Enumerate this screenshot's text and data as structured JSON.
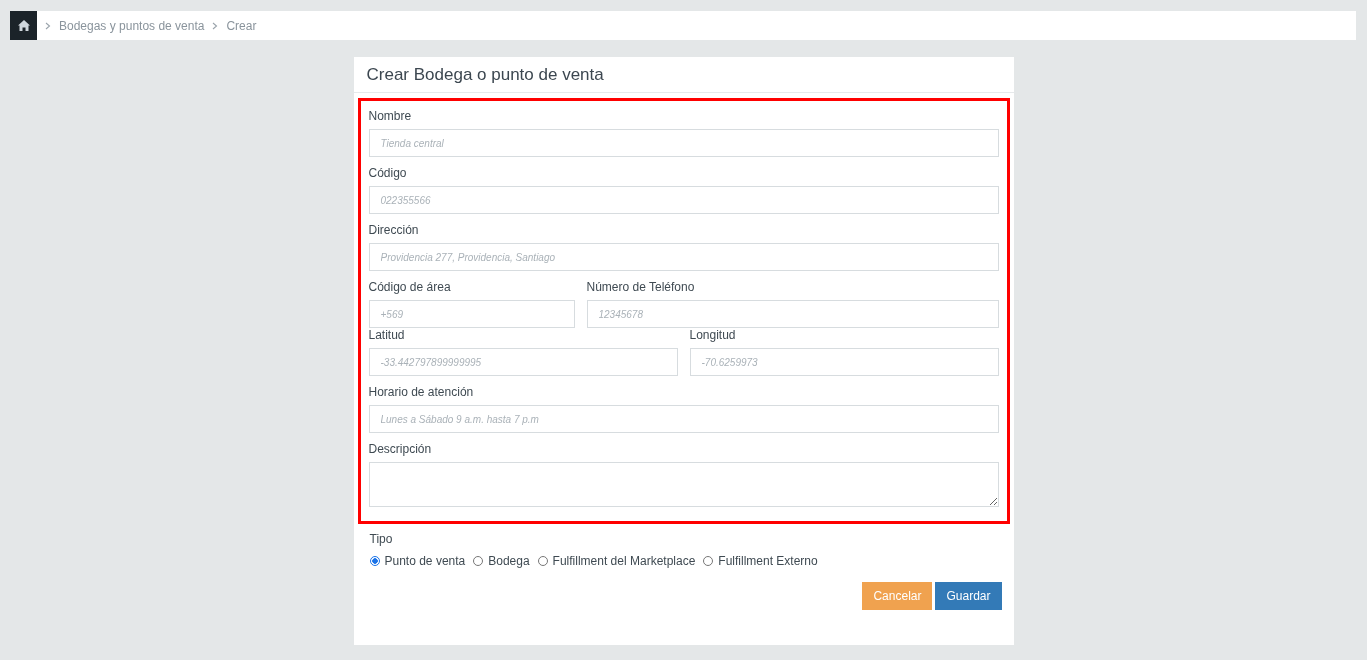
{
  "breadcrumb": {
    "items": [
      "Bodegas y puntos de venta",
      "Crear"
    ]
  },
  "card": {
    "title": "Crear Bodega o punto de venta"
  },
  "form": {
    "highlighted": true,
    "rows": [
      {
        "fields": [
          {
            "kind": "input",
            "label": "Nombre",
            "placeholder": "Tienda central"
          }
        ]
      },
      {
        "fields": [
          {
            "kind": "input",
            "label": "Código",
            "placeholder": "022355566"
          }
        ]
      },
      {
        "fields": [
          {
            "kind": "input",
            "label": "Dirección",
            "placeholder": "Providencia 277, Providencia, Santiago"
          }
        ]
      },
      {
        "fields": [
          {
            "kind": "input",
            "label": "Código de área",
            "placeholder": "+569"
          },
          {
            "kind": "input",
            "label": "Número de Teléfono",
            "placeholder": "12345678"
          }
        ]
      },
      {
        "fields": [
          {
            "kind": "input",
            "label": "Latitud",
            "placeholder": "-33.442797899999995"
          },
          {
            "kind": "input",
            "label": "Longitud",
            "placeholder": "-70.6259973"
          }
        ]
      },
      {
        "fields": [
          {
            "kind": "input",
            "label": "Horario de atención",
            "placeholder": "Lunes a Sábado 9 a.m. hasta 7 p.m"
          }
        ]
      },
      {
        "fields": [
          {
            "kind": "textarea",
            "label": "Descripción"
          }
        ]
      }
    ]
  },
  "tipo": {
    "label": "Tipo",
    "options": [
      {
        "label": "Punto de venta",
        "selected": true
      },
      {
        "label": "Bodega",
        "selected": false
      },
      {
        "label": "Fulfillment del Marketplace",
        "selected": false
      },
      {
        "label": "Fulfillment Externo",
        "selected": false
      }
    ]
  },
  "buttons": [
    {
      "kind": "cancel",
      "label": "Cancelar"
    },
    {
      "kind": "primary",
      "label": "Guardar"
    }
  ]
}
